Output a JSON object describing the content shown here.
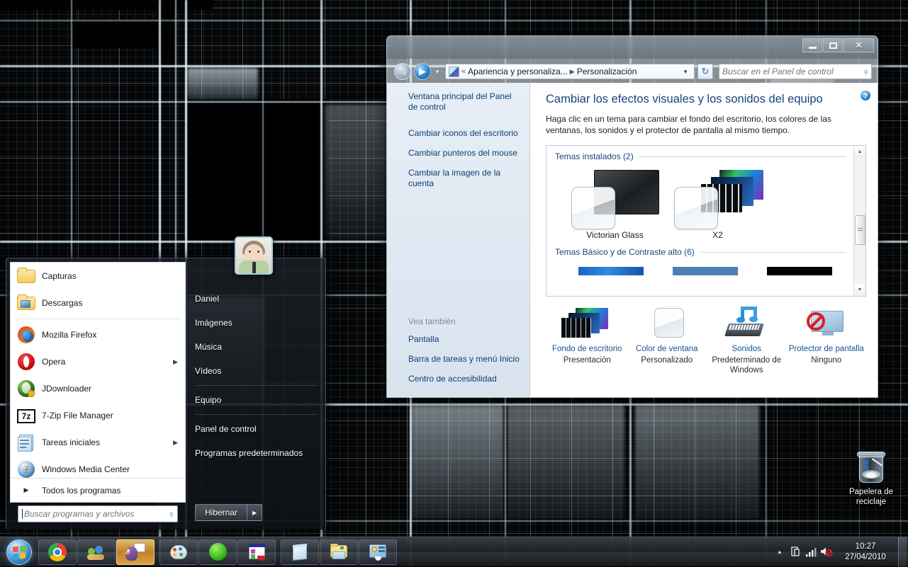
{
  "desktop": {
    "recycle_bin_label": "Papelera de\nreciclaje",
    "recycle_bin_line1": "Papelera de",
    "recycle_bin_line2": "reciclaje"
  },
  "control_panel": {
    "window_buttons": {
      "minimize": "–",
      "maximize": "□",
      "close": "✕"
    },
    "address": {
      "chevrons": "«",
      "segment1": "Apariencia y personaliza...",
      "separator": "▶",
      "segment2": "Personalización",
      "dropdown_caret": "▼",
      "refresh": "↻"
    },
    "search": {
      "placeholder": "Buscar en el Panel de control",
      "value": ""
    },
    "help_glyph": "?",
    "sidebar": {
      "links": [
        "Ventana principal del Panel de control",
        "Cambiar iconos del escritorio",
        "Cambiar punteros del mouse",
        "Cambiar la imagen de la cuenta"
      ],
      "see_also_title": "Vea también",
      "see_also_links": [
        "Pantalla",
        "Barra de tareas y menú Inicio",
        "Centro de accesibilidad"
      ]
    },
    "main": {
      "heading": "Cambiar los efectos visuales y los sonidos del equipo",
      "subtext": "Haga clic en un tema para cambiar el fondo del escritorio, los colores de las ventanas, los sonidos y el protector de pantalla al mismo tiempo.",
      "groups": [
        {
          "label": "Temas instalados (2)",
          "themes": [
            "Victorian Glass",
            "X2"
          ]
        },
        {
          "label": "Temas Básico y de Contraste alto (6)",
          "themes": []
        }
      ],
      "scrollbar": {
        "up": "▲",
        "down": "▼"
      },
      "options": [
        {
          "title": "Fondo de escritorio",
          "value": "Presentación",
          "icon": "wallpaper-stack-icon"
        },
        {
          "title": "Color de ventana",
          "value": "Personalizado",
          "icon": "window-color-icon"
        },
        {
          "title": "Sonidos",
          "value": "Predeterminado de Windows",
          "icon": "sounds-icon"
        },
        {
          "title": "Protector de pantalla",
          "value": "Ninguno",
          "icon": "screensaver-icon"
        }
      ]
    }
  },
  "start_menu": {
    "left_items": [
      {
        "label": "Capturas",
        "icon": "folder-icon",
        "arrow": ""
      },
      {
        "label": "Descargas",
        "icon": "downloads-folder-icon",
        "arrow": ""
      },
      {
        "sep": true
      },
      {
        "label": "Mozilla Firefox",
        "icon": "firefox-icon",
        "arrow": ""
      },
      {
        "label": "Opera",
        "icon": "opera-icon",
        "arrow": "▶"
      },
      {
        "label": "JDownloader",
        "icon": "jdownloader-icon",
        "arrow": ""
      },
      {
        "label": "7-Zip File Manager",
        "icon": "sevenzip-icon",
        "arrow": ""
      },
      {
        "label": "Tareas iniciales",
        "icon": "getting-started-icon",
        "arrow": "▶"
      },
      {
        "label": "Windows Media Center",
        "icon": "media-center-icon",
        "arrow": ""
      }
    ],
    "all_programs": {
      "label": "Todos los programas",
      "arrow": "▶"
    },
    "search": {
      "placeholder": "Buscar programas y archivos",
      "value": "",
      "icon": "search-icon"
    },
    "right_items": [
      {
        "label": "Daniel"
      },
      {
        "label": "Imágenes"
      },
      {
        "label": "Música"
      },
      {
        "label": "Vídeos"
      },
      {
        "sep": true
      },
      {
        "label": "Equipo"
      },
      {
        "sep": true
      },
      {
        "label": "Panel de control"
      },
      {
        "label": "Programas predeterminados"
      }
    ],
    "power": {
      "label": "Hibernar",
      "more_arrow": "▶"
    },
    "avatar": "user-avatar"
  },
  "taskbar": {
    "start_orb": "windows-start-orb",
    "buttons": [
      {
        "name": "google-chrome",
        "active": false
      },
      {
        "name": "windows-live-messenger",
        "active": false
      },
      {
        "name": "adium-duck",
        "active": true
      },
      {
        "name": "paint",
        "active": false
      },
      {
        "name": "spotify",
        "active": false
      },
      {
        "name": "snipping-tool",
        "active": false
      },
      {
        "name": "notepad",
        "active": false
      },
      {
        "name": "windows-explorer",
        "active": false
      },
      {
        "name": "control-panel",
        "active": false
      }
    ],
    "tray": [
      {
        "name": "show-hidden-icons",
        "glyph": "▲"
      },
      {
        "name": "action-center",
        "glyph": "🗒"
      },
      {
        "name": "network",
        "glyph": "▮"
      },
      {
        "name": "volume-muted",
        "glyph": "🔇"
      }
    ],
    "clock": {
      "time": "10:27",
      "date": "27/04/2010"
    }
  },
  "colors": {
    "accent_link": "#15538f",
    "heading": "#17457c",
    "taskbar_active": "#eca024",
    "theme_aero": "#1568c8",
    "theme_basic": "#4d7fb5",
    "theme_highcontrast": "#000000"
  }
}
